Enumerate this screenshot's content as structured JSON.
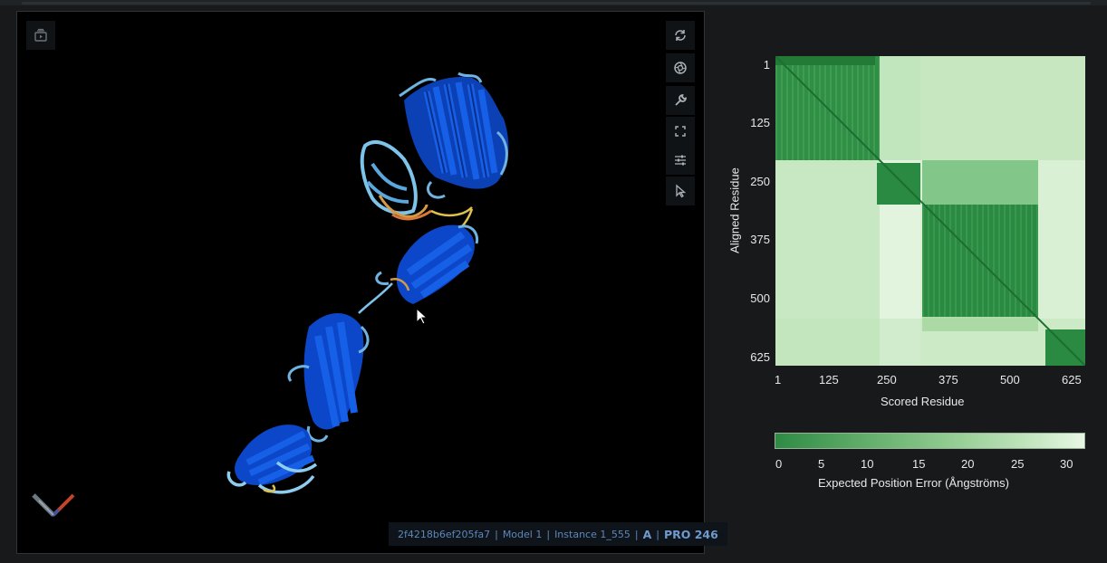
{
  "viewer": {
    "toolbar_left": {
      "icon": "animation-icon"
    },
    "toolbar_right": [
      {
        "icon": "reset-camera-icon"
      },
      {
        "icon": "screenshot-icon"
      },
      {
        "icon": "wrench-icon"
      },
      {
        "icon": "fullscreen-icon"
      },
      {
        "icon": "settings-sliders-icon"
      },
      {
        "icon": "selection-mode-icon"
      }
    ],
    "status": {
      "entry_id": "2f4218b6ef205fa7",
      "model": "Model 1",
      "instance": "Instance 1_555",
      "chain": "A",
      "residue": "PRO 246"
    }
  },
  "pae_plot": {
    "y_ticks": [
      "1",
      "125",
      "250",
      "375",
      "500",
      "625"
    ],
    "x_ticks": [
      "1",
      "125",
      "250",
      "375",
      "500",
      "625"
    ],
    "ylabel": "Aligned Residue",
    "xlabel": "Scored Residue",
    "colorbar_ticks": [
      "0",
      "5",
      "10",
      "15",
      "20",
      "25",
      "30"
    ],
    "colorbar_label": "Expected Position Error (Ångströms)",
    "colors": {
      "low": "#2e8b44",
      "high": "#e8f6e5"
    }
  }
}
